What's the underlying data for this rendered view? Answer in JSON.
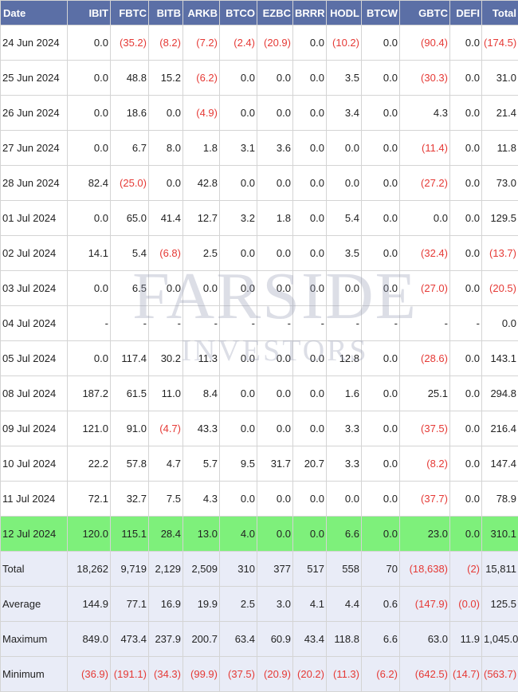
{
  "columns": [
    "Date",
    "IBIT",
    "FBTC",
    "BITB",
    "ARKB",
    "BTCO",
    "EZBC",
    "BRRR",
    "HODL",
    "BTCW",
    "GBTC",
    "DEFI",
    "Total"
  ],
  "rows": [
    {
      "date": "24 Jun 2024",
      "values": [
        "0.0",
        "(35.2)",
        "(8.2)",
        "(7.2)",
        "(2.4)",
        "(20.9)",
        "0.0",
        "(10.2)",
        "0.0",
        "(90.4)",
        "0.0",
        "(174.5)"
      ]
    },
    {
      "date": "25 Jun 2024",
      "values": [
        "0.0",
        "48.8",
        "15.2",
        "(6.2)",
        "0.0",
        "0.0",
        "0.0",
        "3.5",
        "0.0",
        "(30.3)",
        "0.0",
        "31.0"
      ]
    },
    {
      "date": "26 Jun 2024",
      "values": [
        "0.0",
        "18.6",
        "0.0",
        "(4.9)",
        "0.0",
        "0.0",
        "0.0",
        "3.4",
        "0.0",
        "4.3",
        "0.0",
        "21.4"
      ]
    },
    {
      "date": "27 Jun 2024",
      "values": [
        "0.0",
        "6.7",
        "8.0",
        "1.8",
        "3.1",
        "3.6",
        "0.0",
        "0.0",
        "0.0",
        "(11.4)",
        "0.0",
        "11.8"
      ]
    },
    {
      "date": "28 Jun 2024",
      "values": [
        "82.4",
        "(25.0)",
        "0.0",
        "42.8",
        "0.0",
        "0.0",
        "0.0",
        "0.0",
        "0.0",
        "(27.2)",
        "0.0",
        "73.0"
      ]
    },
    {
      "date": "01 Jul 2024",
      "values": [
        "0.0",
        "65.0",
        "41.4",
        "12.7",
        "3.2",
        "1.8",
        "0.0",
        "5.4",
        "0.0",
        "0.0",
        "0.0",
        "129.5"
      ]
    },
    {
      "date": "02 Jul 2024",
      "values": [
        "14.1",
        "5.4",
        "(6.8)",
        "2.5",
        "0.0",
        "0.0",
        "0.0",
        "3.5",
        "0.0",
        "(32.4)",
        "0.0",
        "(13.7)"
      ]
    },
    {
      "date": "03 Jul 2024",
      "values": [
        "0.0",
        "6.5",
        "0.0",
        "0.0",
        "0.0",
        "0.0",
        "0.0",
        "0.0",
        "0.0",
        "(27.0)",
        "0.0",
        "(20.5)"
      ]
    },
    {
      "date": "04 Jul 2024",
      "values": [
        "-",
        "-",
        "-",
        "-",
        "-",
        "-",
        "-",
        "-",
        "-",
        "-",
        "-",
        "0.0"
      ]
    },
    {
      "date": "05 Jul 2024",
      "values": [
        "0.0",
        "117.4",
        "30.2",
        "11.3",
        "0.0",
        "0.0",
        "0.0",
        "12.8",
        "0.0",
        "(28.6)",
        "0.0",
        "143.1"
      ]
    },
    {
      "date": "08 Jul 2024",
      "values": [
        "187.2",
        "61.5",
        "11.0",
        "8.4",
        "0.0",
        "0.0",
        "0.0",
        "1.6",
        "0.0",
        "25.1",
        "0.0",
        "294.8"
      ]
    },
    {
      "date": "09 Jul 2024",
      "values": [
        "121.0",
        "91.0",
        "(4.7)",
        "43.3",
        "0.0",
        "0.0",
        "0.0",
        "3.3",
        "0.0",
        "(37.5)",
        "0.0",
        "216.4"
      ]
    },
    {
      "date": "10 Jul 2024",
      "values": [
        "22.2",
        "57.8",
        "4.7",
        "5.7",
        "9.5",
        "31.7",
        "20.7",
        "3.3",
        "0.0",
        "(8.2)",
        "0.0",
        "147.4"
      ]
    },
    {
      "date": "11 Jul 2024",
      "values": [
        "72.1",
        "32.7",
        "7.5",
        "4.3",
        "0.0",
        "0.0",
        "0.0",
        "0.0",
        "0.0",
        "(37.7)",
        "0.0",
        "78.9"
      ]
    },
    {
      "date": "12 Jul 2024",
      "values": [
        "120.0",
        "115.1",
        "28.4",
        "13.0",
        "4.0",
        "0.0",
        "0.0",
        "6.6",
        "0.0",
        "23.0",
        "0.0",
        "310.1"
      ],
      "highlight": true
    }
  ],
  "summary": [
    {
      "label": "Total",
      "values": [
        "18,262",
        "9,719",
        "2,129",
        "2,509",
        "310",
        "377",
        "517",
        "558",
        "70",
        "(18,638)",
        "(2)",
        "15,811"
      ]
    },
    {
      "label": "Average",
      "values": [
        "144.9",
        "77.1",
        "16.9",
        "19.9",
        "2.5",
        "3.0",
        "4.1",
        "4.4",
        "0.6",
        "(147.9)",
        "(0.0)",
        "125.5"
      ]
    },
    {
      "label": "Maximum",
      "values": [
        "849.0",
        "473.4",
        "237.9",
        "200.7",
        "63.4",
        "60.9",
        "43.4",
        "118.8",
        "6.6",
        "63.0",
        "11.9",
        "1,045.0"
      ]
    },
    {
      "label": "Minimum",
      "values": [
        "(36.9)",
        "(191.1)",
        "(34.3)",
        "(99.9)",
        "(37.5)",
        "(20.9)",
        "(20.2)",
        "(11.3)",
        "(6.2)",
        "(642.5)",
        "(14.7)",
        "(563.7)"
      ]
    }
  ],
  "watermark": {
    "line1": "FARSIDE",
    "line2": "INVESTORS"
  },
  "colors": {
    "header_bg": "#5b6fa6",
    "negative": "#e53935",
    "highlight_row": "#7ef07b",
    "summary_bg": "#e9ecf7"
  }
}
